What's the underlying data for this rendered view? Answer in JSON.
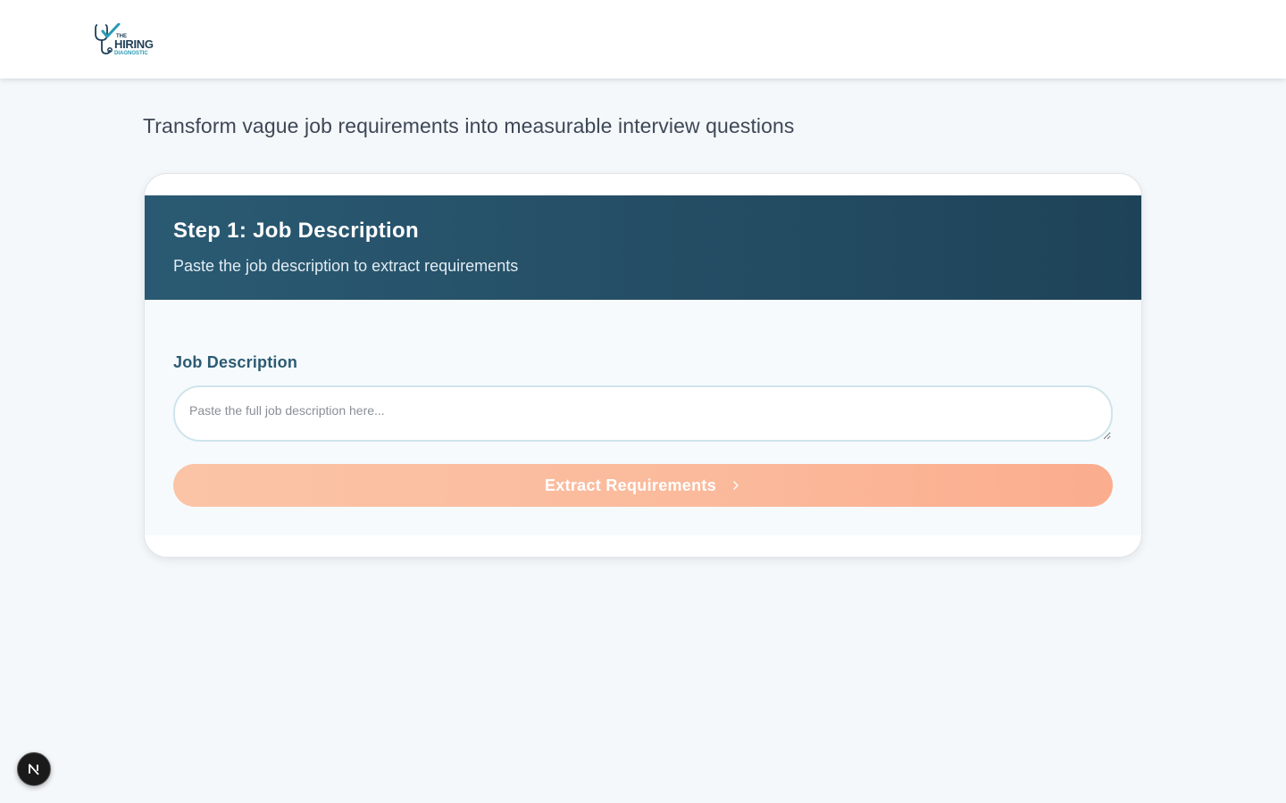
{
  "header": {
    "logo": {
      "top_text": "THE",
      "main_text": "HIRING",
      "sub_text": "DIAGNOSTIC",
      "icon": "stethoscope-check-icon"
    }
  },
  "page": {
    "tagline": "Transform vague job requirements into measurable interview questions"
  },
  "step_card": {
    "title": "Step 1: Job Description",
    "subtitle": "Paste the job description to extract requirements",
    "field_label": "Job Description",
    "input_placeholder": "Paste the full job description here...",
    "input_value": "",
    "button_label": "Extract Requirements",
    "button_icon": "chevron-right-icon",
    "button_enabled": false
  },
  "dev_badge": {
    "letter": "N",
    "icon": "nextjs-icon"
  },
  "colors": {
    "page_background": "#f4f8fb",
    "header_gradient_start": "#2a5a73",
    "header_gradient_end": "#1e4359",
    "label_color": "#2b5a73",
    "button_gradient_start": "#fbc4a6",
    "button_gradient_end": "#fbad8e",
    "logo_teal": "#2a9bb5",
    "logo_navy": "#1f3f57"
  }
}
